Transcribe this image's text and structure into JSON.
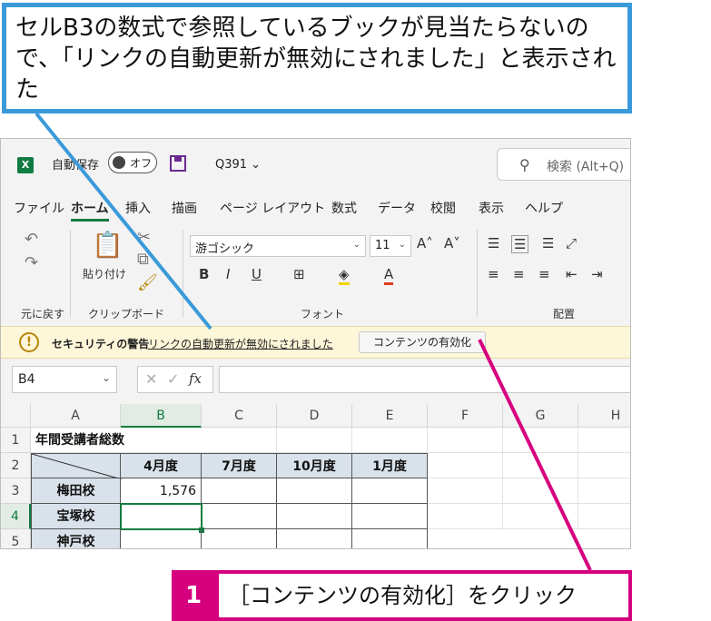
{
  "callout": {
    "text": "セルB3の数式で参照しているブックが見当たらないので、「リンクの自動更新が無効にされました」と表示された"
  },
  "titlebar": {
    "app_icon": "excel-icon",
    "autosave_label": "自動保存",
    "toggle_state": "オフ",
    "filename": "Q391 ⌄",
    "search_placeholder": "検索 (Alt+Q)"
  },
  "menu": {
    "items": [
      "ファイル",
      "ホーム",
      "挿入",
      "描画",
      "ページ レイアウト",
      "数式",
      "データ",
      "校閲",
      "表示",
      "ヘルプ"
    ],
    "active": "ホーム"
  },
  "ribbon": {
    "undo_label": "元に戻す",
    "paste_label": "貼り付け",
    "clipboard_label": "クリップボード",
    "font_name": "游ゴシック",
    "font_size": "11",
    "font_group_label": "フォント",
    "align_group_label": "配置",
    "bold": "B",
    "italic": "I",
    "underline": "U"
  },
  "security_bar": {
    "title": "セキュリティの警告",
    "message": "リンクの自動更新が無効にされました",
    "button": "コンテンツの有効化"
  },
  "formula_bar": {
    "name_box": "B4",
    "fx": "fx",
    "value": ""
  },
  "grid": {
    "columns": [
      "A",
      "B",
      "C",
      "D",
      "E",
      "F",
      "G",
      "H"
    ],
    "rows": [
      "1",
      "2",
      "3",
      "4",
      "5"
    ],
    "cells": {
      "A1": "年間受講者総数",
      "B2": "4月度",
      "C2": "7月度",
      "D2": "10月度",
      "E2": "1月度",
      "A3": "梅田校",
      "B3": "1,576",
      "A4": "宝塚校",
      "A5": "神戸校"
    },
    "selected_cell": "B4"
  },
  "step": {
    "number": "1",
    "text": "［コンテンツの有効化］をクリック"
  },
  "colors": {
    "callout_border": "#3a9ad9",
    "step_accent": "#d6007f",
    "excel_green": "#107c41"
  }
}
